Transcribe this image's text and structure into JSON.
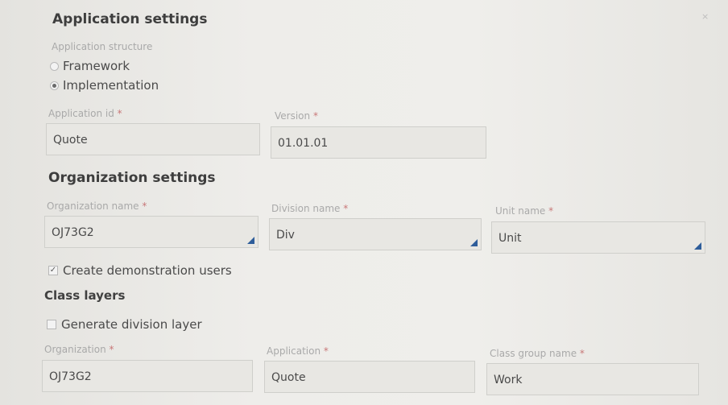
{
  "application_settings": {
    "title": "Application settings",
    "structure_label": "Application structure",
    "options": [
      {
        "label": "Framework",
        "selected": false
      },
      {
        "label": "Implementation",
        "selected": true
      }
    ],
    "app_id_label": "Application id",
    "app_id_value": "Quote",
    "version_label": "Version",
    "version_value": "01.01.01"
  },
  "organization_settings": {
    "title": "Organization settings",
    "org_name_label": "Organization name",
    "org_name_value": "OJ73G2",
    "division_label": "Division name",
    "division_value": "Div",
    "unit_label": "Unit name",
    "unit_value": "Unit",
    "demo_users_label": "Create demonstration users",
    "demo_users_checked": true
  },
  "class_layers": {
    "title": "Class layers",
    "division_layer_label": "Generate division layer",
    "division_layer_checked": false,
    "organization_label": "Organization",
    "organization_value": "OJ73G2",
    "application_label": "Application",
    "application_value": "Quote",
    "class_group_label": "Class group name",
    "class_group_value": "Work"
  },
  "required_marker": "*",
  "close_glyph": "×",
  "colors": {
    "dropdown_arrow": "#2e5d9a",
    "required": "#c87878"
  }
}
